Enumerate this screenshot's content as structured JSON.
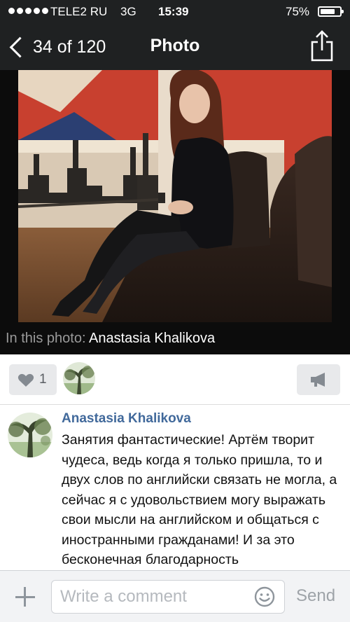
{
  "status_bar": {
    "carrier": "TELE2 RU",
    "network": "3G",
    "time": "15:39",
    "battery_percent_label": "75%",
    "battery_level": 0.75
  },
  "nav": {
    "back_label": "34 of 120",
    "title": "Photo",
    "share_icon": "share-icon"
  },
  "photo": {
    "caption_prefix": "In this photo:",
    "tagged_name": "Anastasia Khalikova"
  },
  "actions": {
    "like_count": "1",
    "like_icon": "heart-icon",
    "announce_icon": "megaphone-icon"
  },
  "comment": {
    "author": "Anastasia Khalikova",
    "text": "Занятия фантастические! Артём творит чудеса, ведь когда я только пришла, то и двух слов по английски связать не могла, а сейчас я с удовольствием могу выражать свои мысли на английском и общаться с иностранными гражданами! И за это бесконечная благодарность"
  },
  "composer": {
    "placeholder": "Write a comment",
    "send_label": "Send",
    "attach_icon": "plus-icon",
    "emoji_icon": "smiley-icon"
  },
  "colors": {
    "header_bg": "#1f2122",
    "link_blue": "#41699b",
    "button_gray": "#e8e9eb"
  }
}
